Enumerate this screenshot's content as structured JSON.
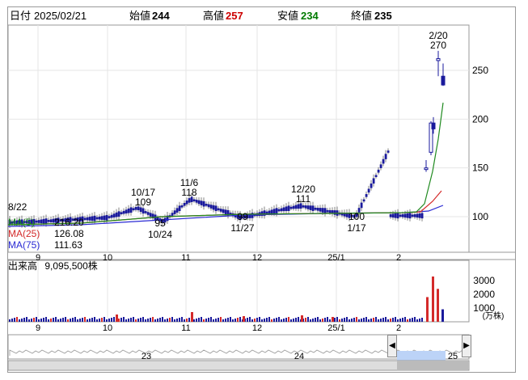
{
  "ohlc": {
    "date_label": "日付",
    "date": "2025/02/21",
    "open_label": "始値",
    "open": "244",
    "high_label": "高値",
    "high": "257",
    "low_label": "安値",
    "low": "234",
    "close_label": "終値",
    "close": "235",
    "colors": {
      "high": "#cc0000",
      "low": "#007a00",
      "text": "#000000"
    }
  },
  "ma_legend": [
    {
      "label": "MA(5)",
      "value": "216.20",
      "color": "#1f8a1f"
    },
    {
      "label": "MA(25)",
      "value": "126.08",
      "color": "#d42a2a"
    },
    {
      "label": "MA(75)",
      "value": "111.63",
      "color": "#2a2ad4"
    }
  ],
  "volume": {
    "title": "出来高",
    "value": "9,095,500株",
    "unit": "(万株)",
    "yticks": [
      "3000",
      "2000",
      "1000"
    ]
  },
  "annotations": [
    {
      "date": "8/22",
      "value": "94"
    },
    {
      "date": "10/17",
      "value": "109"
    },
    {
      "date": "10/24",
      "value": "95"
    },
    {
      "date": "11/6",
      "value": "118"
    },
    {
      "date": "11/27",
      "value": "99"
    },
    {
      "date": "12/20",
      "value": "111"
    },
    {
      "date": "1/17",
      "value": "100"
    },
    {
      "date": "2/20",
      "value": "270"
    }
  ],
  "x_ticks": [
    "9",
    "10",
    "11",
    "12",
    "25/1",
    "2"
  ],
  "nav_labels": [
    "23",
    "24",
    "25"
  ],
  "chart_data": {
    "type": "candlestick",
    "y_ticks": [
      100,
      150,
      200,
      250
    ],
    "ylim": [
      80,
      290
    ],
    "x_ticks": [
      "9",
      "10",
      "11",
      "12",
      "25/1",
      "2"
    ],
    "price_trend": [
      {
        "x": "8/22",
        "y": 94
      },
      {
        "x": "9",
        "y": 95
      },
      {
        "x": "10",
        "y": 99
      },
      {
        "x": "10/17",
        "y": 109
      },
      {
        "x": "10/24",
        "y": 95
      },
      {
        "x": "11/6",
        "y": 118
      },
      {
        "x": "11/27",
        "y": 99
      },
      {
        "x": "12/20",
        "y": 111
      },
      {
        "x": "1/17",
        "y": 100
      },
      {
        "x": "2/20",
        "y": 270
      },
      {
        "x": "2/21",
        "y": 235
      }
    ],
    "last_candle": {
      "open": 244,
      "high": 257,
      "low": 234,
      "close": 235
    },
    "volume_ylim": [
      0,
      3500
    ],
    "volume_spikes_man_shares": [
      1800,
      3300,
      2400,
      910
    ],
    "series": [
      {
        "name": "MA(5)",
        "last": 216.2
      },
      {
        "name": "MA(25)",
        "last": 126.08
      },
      {
        "name": "MA(75)",
        "last": 111.63
      }
    ]
  }
}
